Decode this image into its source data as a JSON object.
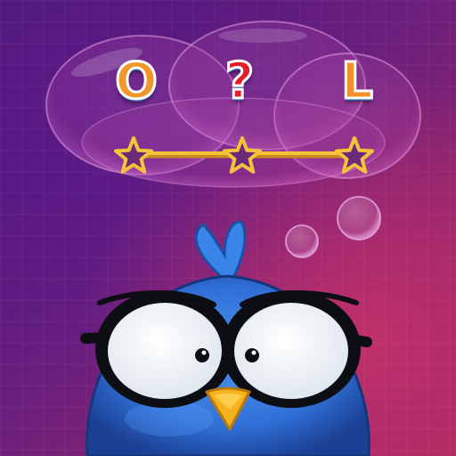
{
  "puzzle": {
    "letters": [
      "O",
      "?",
      "L"
    ],
    "letter_colors": [
      "#f0962a",
      "#e21f2a",
      "#f29028"
    ],
    "stars_total": 3,
    "stars_earned": 0
  },
  "colors": {
    "background_top": "#4a1878",
    "background_bottom": "#a8285f",
    "bird_body": "#2f6fd6",
    "progress_line": "#f3c33a"
  },
  "icons": [
    "thought-bubble-icon",
    "star-icon",
    "bird-mascot"
  ]
}
